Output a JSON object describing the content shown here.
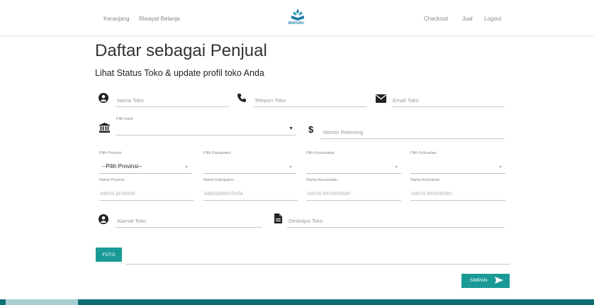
{
  "nav": {
    "links_left": [
      "Keranjang",
      "Riwayat Belanja"
    ],
    "links_right": [
      "Checkout",
      "Jual",
      "Logout"
    ],
    "logo_text": "BUKUKU"
  },
  "page": {
    "title": "Daftar sebagai Penjual",
    "subtitle": "Lihat Status Toko & update profil toko Anda"
  },
  "form": {
    "nama_toko": "Nama Toko",
    "telepon_toko": "Telepon Toko",
    "email_toko": "Email Toko",
    "pilih_bank_label": "Pilih bank",
    "nomer_rekening": "Nomer Rekening",
    "provinsi_label": "Pilih Provinsi",
    "provinsi_value": "--Pilih Provinsi--",
    "kabupaten_label": "Pilih Kabupaten",
    "kecamatan_label": "Pilih Kecamatan",
    "kelurahan_label": "Pilih Kelurahan",
    "nama_provinsi_label": "Nama Provinsi",
    "nama_provinsi_ph": "nama provinsi",
    "nama_kabupaten_label": "Nama Kabupaten",
    "nama_kabupaten_ph": "kabupaten/kota",
    "nama_kecamatan_label": "Nama Kecamatan",
    "nama_kecamatan_ph": "nama kecamatan",
    "nama_kelurahan_label": "Nama Kelurahan",
    "nama_kelurahan_ph": "nama kelurahan",
    "alamat_toko": "Alamat Toko",
    "deskripsi_toko": "Deskripsi Toko",
    "foto_button": "FOTO",
    "simpan_button": "SIMPAN"
  },
  "colors": {
    "accent": "#1a9a97",
    "footer": "#0e6f73"
  }
}
